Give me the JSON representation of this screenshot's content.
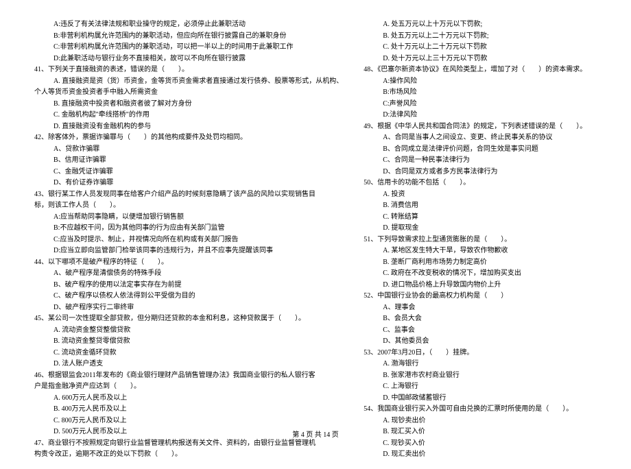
{
  "left": [
    {
      "cls": "indent-1",
      "t": "A:违反了有关法律法规和职业操守的规定，必须停止此兼职活动"
    },
    {
      "cls": "indent-1",
      "t": "B:非营利机构属允许范围内的兼职活动，但应向所在银行披露自己的兼职身份"
    },
    {
      "cls": "indent-1",
      "t": "C:非营利机构属允许范围内的兼职活动，可以把一半以上的时间用于此兼职工作"
    },
    {
      "cls": "indent-1",
      "t": "D:此兼职活动与银行业务不直接相关，故可以不向所在银行披露"
    },
    {
      "cls": "q-start",
      "t": "41、下列关于直接融资的表述，错误的是（　　）。"
    },
    {
      "cls": "indent-1",
      "t": "A. 直接融资是资（货）币资金，金等货币资金需求者直接通过发行债券、股票等形式，从机构、"
    },
    {
      "cls": "q-start",
      "t": "个人等货币资金投资者手中融入所需资金"
    },
    {
      "cls": "indent-1",
      "t": "B. 直接融资中投资者和融资者彼了解对方身份"
    },
    {
      "cls": "indent-1",
      "t": "C. 金融机构起\"牵线搭桥\"的作用"
    },
    {
      "cls": "indent-1",
      "t": "D. 直接融资没有金融机构的参与"
    },
    {
      "cls": "q-start",
      "t": "42、除客体外，票据诈骗罪与（　　）的其他构成要件及处罚均相同。"
    },
    {
      "cls": "indent-1",
      "t": "A、贷款诈骗罪"
    },
    {
      "cls": "indent-1",
      "t": "B、信用证诈骗罪"
    },
    {
      "cls": "indent-1",
      "t": "C、金融凭证诈骗罪"
    },
    {
      "cls": "indent-1",
      "t": "D、有价证券诈骗罪"
    },
    {
      "cls": "q-start",
      "t": "43、银行某工作人员发现同事在给客户介绍产品的时候刻意隐瞒了该产品的风险以实现销售目"
    },
    {
      "cls": "q-start",
      "t": "标，则该工作人员（　　）。"
    },
    {
      "cls": "indent-1",
      "t": "A:应当帮助同事隐瞒，以便增加银行销售额"
    },
    {
      "cls": "indent-1",
      "t": "B:不应越权干问，因为其他同事的行为应由有关部门监管"
    },
    {
      "cls": "indent-1",
      "t": "C:应当及时提示、制止，并视情况向所在机构或有关部门报告"
    },
    {
      "cls": "indent-1",
      "t": "D:应当立即向监管部门检举该同事的违规行为，并且不应事先提醒该同事"
    },
    {
      "cls": "q-start",
      "t": "44、以下哪项不是破产程序的特征（　　）。"
    },
    {
      "cls": "indent-1",
      "t": "A、破产程序是清偿债务的特殊手段"
    },
    {
      "cls": "indent-1",
      "t": "B、破产程序的使用以法定事实存在为前提"
    },
    {
      "cls": "indent-1",
      "t": "C、破产程序以债权人依法得到公平受偿为目的"
    },
    {
      "cls": "indent-1",
      "t": "D、破产程序实行二审终审"
    },
    {
      "cls": "q-start",
      "t": "45、某公司一次性提取全部贷款，但分期归还贷款的本金和利息，这种贷款属于（　　）。"
    },
    {
      "cls": "indent-1",
      "t": "A. 流动资金整贷整偿贷款"
    },
    {
      "cls": "indent-1",
      "t": "B. 流动资金整贷零偿贷款"
    },
    {
      "cls": "indent-1",
      "t": "C. 流动资金循环贷款"
    },
    {
      "cls": "indent-1",
      "t": "D. 法人账户透支"
    },
    {
      "cls": "q-start",
      "t": "46、根据银监会2011年发布的《商业银行理财产品销售管理办法》我国商业银行的私人银行客"
    },
    {
      "cls": "q-start",
      "t": "户是指金融净资产应达到（　　）。"
    },
    {
      "cls": "indent-1",
      "t": "A. 600万元人民币及以上"
    },
    {
      "cls": "indent-1",
      "t": "B. 400万元人民币及以上"
    },
    {
      "cls": "indent-1",
      "t": "C. 800万元人民币及以上"
    },
    {
      "cls": "indent-1",
      "t": "D. 500万元人民币及以上"
    },
    {
      "cls": "q-start",
      "t": "47、商业银行不按照规定向银行业监督管理机构报送有关文件、资料的，由银行业监督管理机"
    },
    {
      "cls": "q-start",
      "t": "构责令改正，逾期不改正的处以下罚款（　　）。"
    }
  ],
  "right": [
    {
      "cls": "indent-1",
      "t": "A. 处五万元以上十万元以下罚款;"
    },
    {
      "cls": "indent-1",
      "t": "B. 处五万元以上二十万元以下罚款;"
    },
    {
      "cls": "indent-1",
      "t": "C. 处十万元以上二十万元以下罚款"
    },
    {
      "cls": "indent-1",
      "t": "D. 处十万元以上三十万元以下罚款"
    },
    {
      "cls": "q-start",
      "t": "48、《巴塞尔新资本协议》在风险类型上，增加了对（　　）的资本需求。"
    },
    {
      "cls": "indent-1",
      "t": "A:操作风险"
    },
    {
      "cls": "indent-1",
      "t": "B:市场风险"
    },
    {
      "cls": "indent-1",
      "t": "C:声誉风险"
    },
    {
      "cls": "indent-1",
      "t": "D:法律风险"
    },
    {
      "cls": "q-start",
      "t": "49、根据《中华人民共和国合同法》的规定，下列表述错误的是（　　）。"
    },
    {
      "cls": "indent-1",
      "t": "A、合同是当事人之间设立、变更、终止民事关系的协议"
    },
    {
      "cls": "indent-1",
      "t": "B、合同成立是法律评价问题，合同生效是事实问题"
    },
    {
      "cls": "indent-1",
      "t": "C、合同是一种民事法律行为"
    },
    {
      "cls": "indent-1",
      "t": "D、合同是双方或者多方民事法律行为"
    },
    {
      "cls": "q-start",
      "t": "50、信用卡的功能不包括（　　）。"
    },
    {
      "cls": "indent-1",
      "t": "A. 投资"
    },
    {
      "cls": "indent-1",
      "t": "B. 消费信用"
    },
    {
      "cls": "indent-1",
      "t": "C. 转账结算"
    },
    {
      "cls": "indent-1",
      "t": "D. 提取现金"
    },
    {
      "cls": "q-start",
      "t": "51、下列导致需求拉上型通货膨胀的是（　　）。"
    },
    {
      "cls": "indent-1",
      "t": "A. 某地区发生特大干旱，导致农作物歉收"
    },
    {
      "cls": "indent-1",
      "t": "B. 垄断厂商利用市场势力制定高价"
    },
    {
      "cls": "indent-1",
      "t": "C. 政府在不改变税收的情况下，增加购买支出"
    },
    {
      "cls": "indent-1",
      "t": "D. 进口物品价格上升导致国内物价上升"
    },
    {
      "cls": "q-start",
      "t": "52、中国银行业协会的最高权力机构是（　　）"
    },
    {
      "cls": "indent-1",
      "t": "A、理事会"
    },
    {
      "cls": "indent-1",
      "t": "B、会员大会"
    },
    {
      "cls": "indent-1",
      "t": "C、监事会"
    },
    {
      "cls": "indent-1",
      "t": "D、其他委员会"
    },
    {
      "cls": "q-start",
      "t": "53、2007年3月20日，（　　）挂牌。"
    },
    {
      "cls": "indent-1",
      "t": "A. 渤海银行"
    },
    {
      "cls": "indent-1",
      "t": "B. 张家港市农村商业银行"
    },
    {
      "cls": "indent-1",
      "t": "C. 上海银行"
    },
    {
      "cls": "indent-1",
      "t": "D. 中国邮政储蓄银行"
    },
    {
      "cls": "q-start",
      "t": "54、我国商业银行买入外国可自由兑换的汇票时所使用的是（　　）。"
    },
    {
      "cls": "indent-1",
      "t": "A. 现钞卖出价"
    },
    {
      "cls": "indent-1",
      "t": "B. 现汇买入价"
    },
    {
      "cls": "indent-1",
      "t": "C. 现钞买入价"
    },
    {
      "cls": "indent-1",
      "t": "D. 现汇卖出价"
    }
  ],
  "footer": "第 4 页 共 14 页"
}
